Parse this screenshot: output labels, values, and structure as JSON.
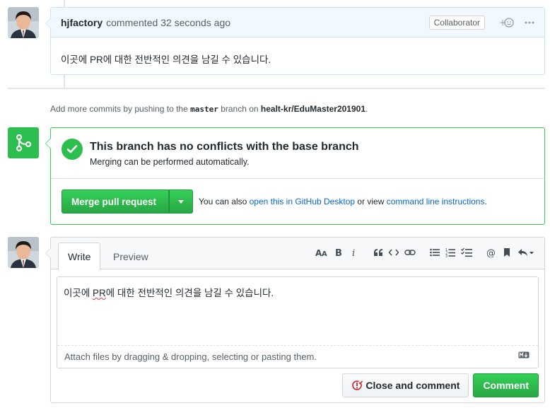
{
  "comment": {
    "author": "hjfactory",
    "action_time": "commented 32 seconds ago",
    "role_badge": "Collaborator",
    "body": "이곳에 PR에 대한 전반적인 의견을 남길 수 있습니다."
  },
  "push_note": {
    "prefix": "Add more commits by pushing to the",
    "branch": "master",
    "middle": "branch on",
    "repo": "healt-kr/EduMaster201901",
    "suffix": "."
  },
  "merge": {
    "status_title": "This branch has no conflicts with the base branch",
    "status_subtitle": "Merging can be performed automatically.",
    "button_label": "Merge pull request",
    "alt_prefix": "You can also",
    "alt_link_desktop": "open this in GitHub Desktop",
    "alt_middle": "or view",
    "alt_link_cli": "command line instructions",
    "alt_suffix": "."
  },
  "form": {
    "tab_write": "Write",
    "tab_preview": "Preview",
    "text_before": "이곳에 ",
    "text_flagged": "PR",
    "text_after": "에 대한 전반적인 의견을 남길 수 있습니다.",
    "attach_hint": "Attach files by dragging & dropping, selecting or pasting them.",
    "close_button": "Close and comment",
    "comment_button": "Comment"
  },
  "colors": {
    "green": "#28a745",
    "link": "#0366d6",
    "comment_header": "#f1f8ff"
  },
  "icons": [
    "avatar",
    "add-reaction-icon",
    "more-icon",
    "git-merge-icon",
    "check-icon",
    "dropdown-caret-icon",
    "text-size-icon",
    "bold-icon",
    "italic-icon",
    "quote-icon",
    "code-icon",
    "link-icon",
    "bullet-list-icon",
    "numbered-list-icon",
    "task-list-icon",
    "mention-icon",
    "reference-icon",
    "reply-icon",
    "markdown-icon",
    "issue-closed-icon"
  ]
}
